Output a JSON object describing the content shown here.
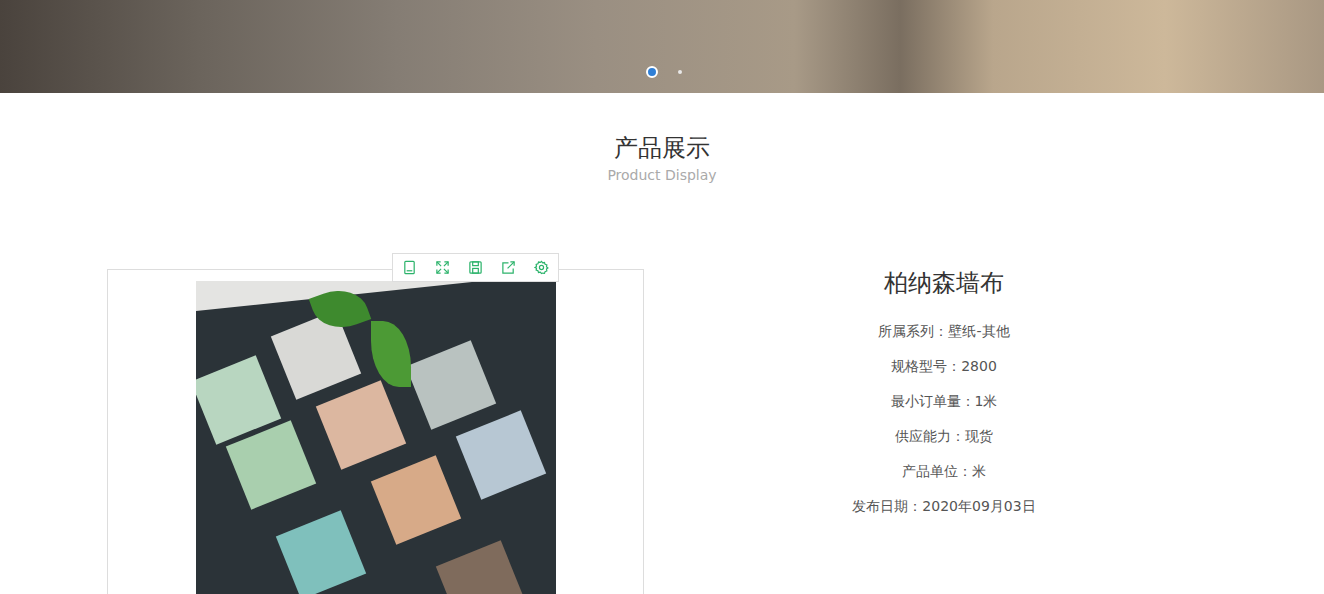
{
  "banner": {
    "dots": [
      {
        "selected": true
      },
      {
        "selected": false
      }
    ]
  },
  "section": {
    "title": "产品展示",
    "subtitle": "Product Display"
  },
  "toolbar": {
    "tools": [
      {
        "name": "tablet"
      },
      {
        "name": "expand"
      },
      {
        "name": "save"
      },
      {
        "name": "share"
      },
      {
        "name": "settings"
      }
    ]
  },
  "product": {
    "title": "柏纳森墙布",
    "fields": [
      {
        "label": "所属系列：",
        "value": "壁纸-其他"
      },
      {
        "label": "规格型号：",
        "value": "2800"
      },
      {
        "label": "最小订单量：",
        "value": "1米"
      },
      {
        "label": "供应能力：",
        "value": "现货"
      },
      {
        "label": "产品单位：",
        "value": "米"
      },
      {
        "label": "发布日期：",
        "value": "2020年09月03日"
      }
    ]
  }
}
